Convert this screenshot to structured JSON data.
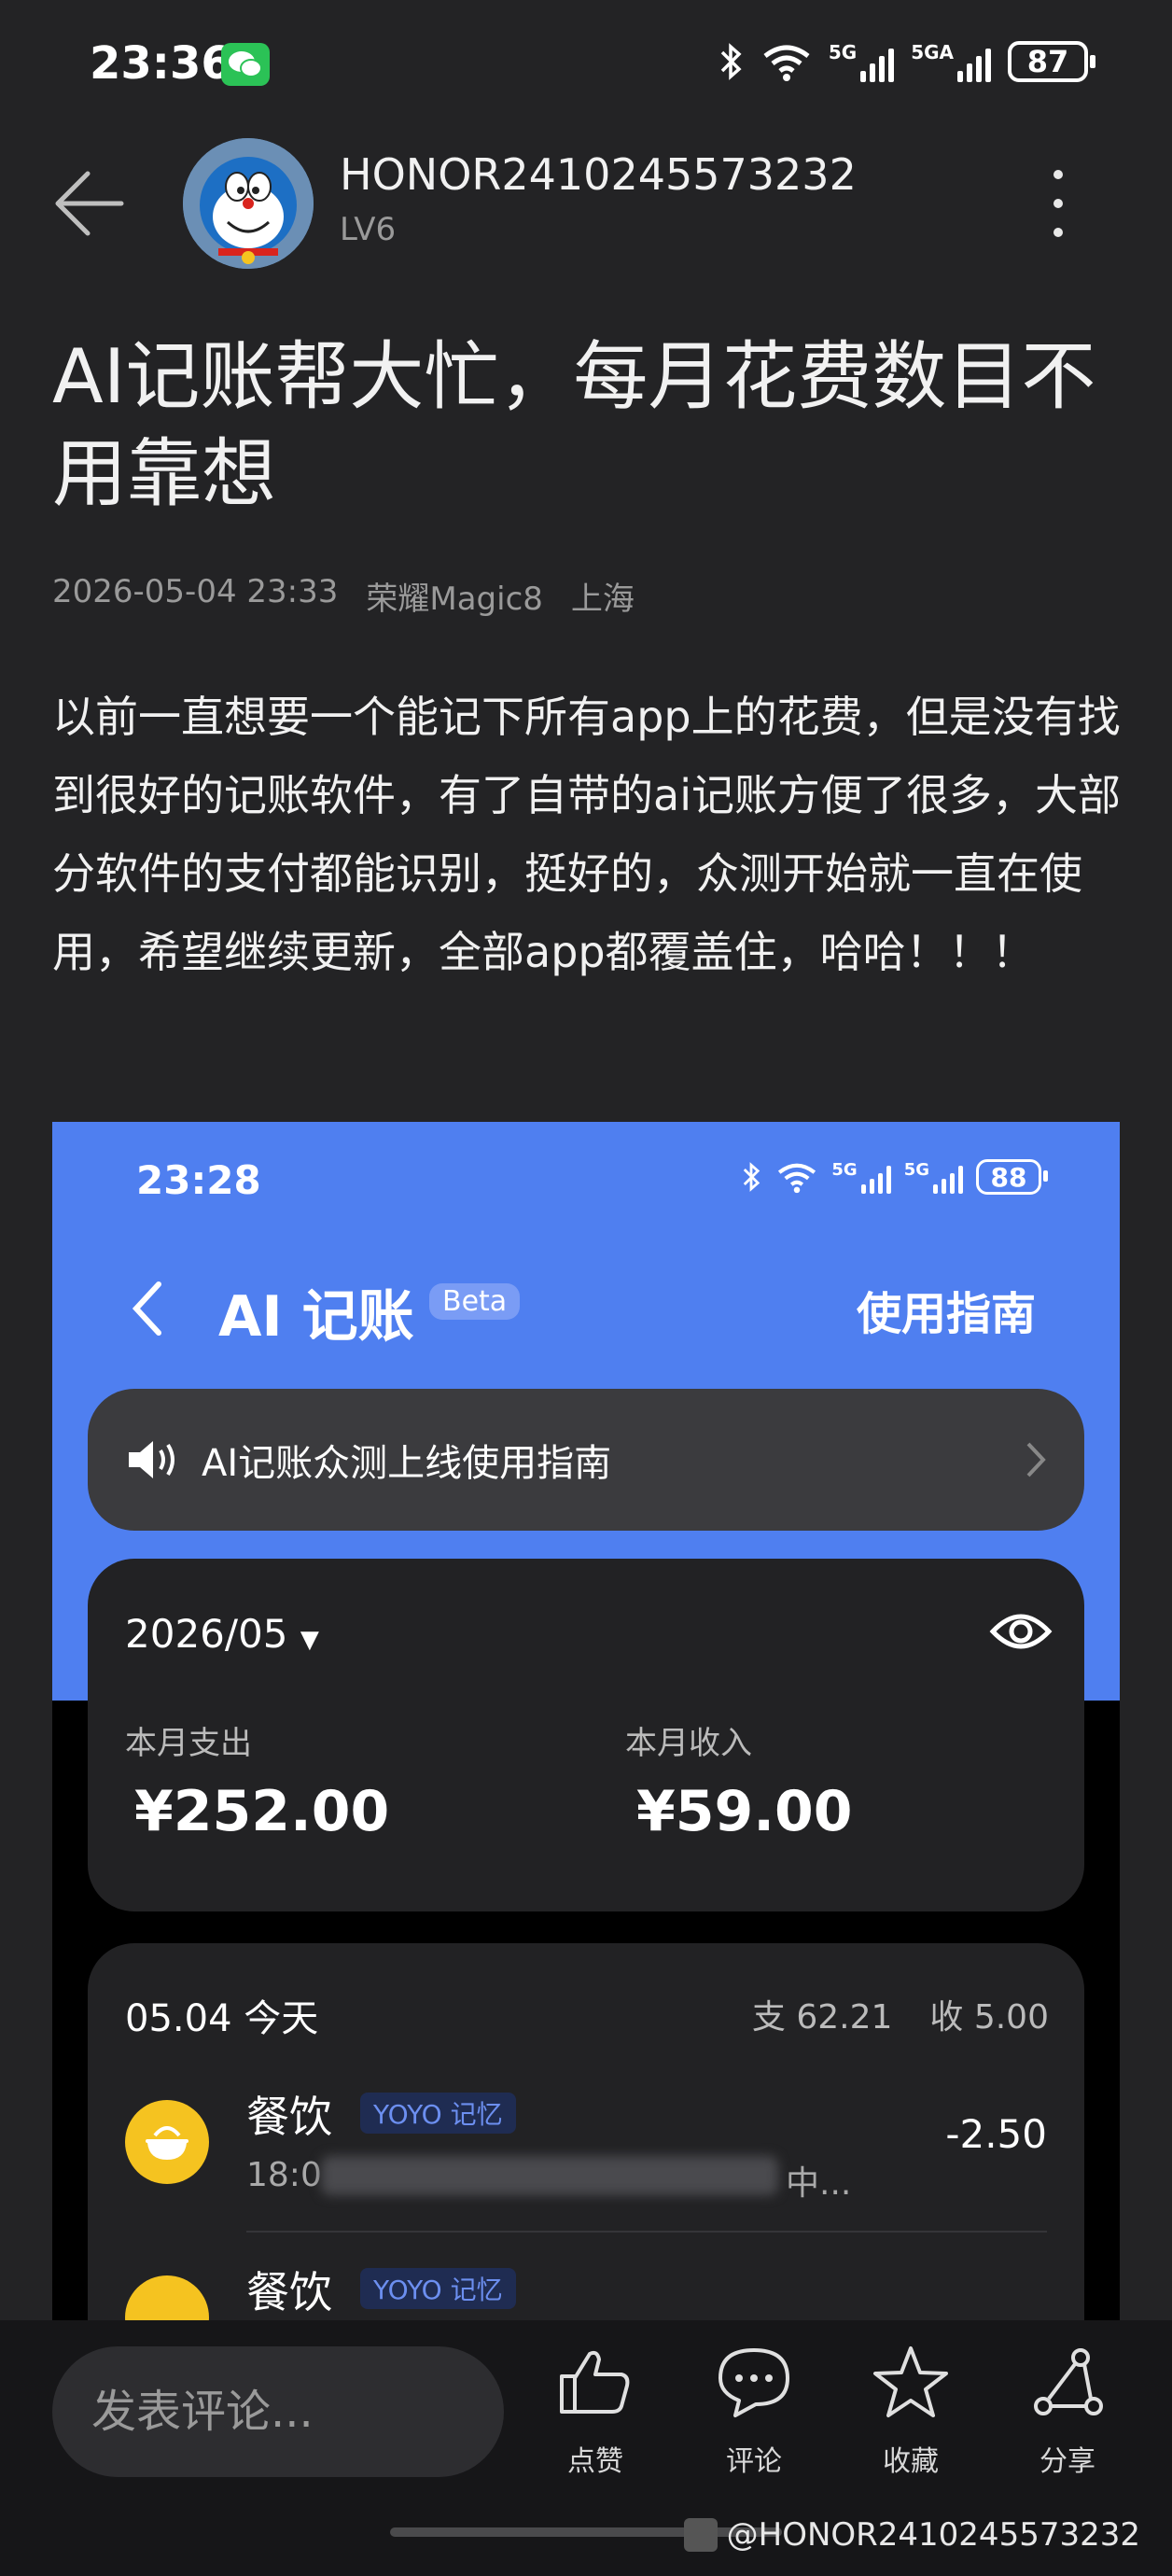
{
  "status_bar": {
    "time": "23:36",
    "sig1_label": "5G",
    "sig2_label": "5GA",
    "battery": "87"
  },
  "author": {
    "name": "HONOR2410245573232",
    "level": "LV6"
  },
  "post": {
    "title": "AI记账帮大忙，每月花费数目不用靠想",
    "datetime": "2026-05-04 23:33",
    "device": "荣耀Magic8",
    "location": "上海",
    "body": "以前一直想要一个能记下所有app上的花费，但是没有找到很好的记账软件，有了自带的ai记账方便了很多，大部分软件的支付都能识别，挺好的，众测开始就一直在使用，希望继续更新，全部app都覆盖住，哈哈！！！"
  },
  "screenshot": {
    "time": "23:28",
    "sig1_label": "5G",
    "sig2_label": "5G",
    "battery": "88",
    "title": "AI 记账",
    "beta": "Beta",
    "guide": "使用指南",
    "notice": "AI记账众测上线使用指南",
    "month": "2026/05",
    "expense_label": "本月支出",
    "expense_value": "¥252.00",
    "income_label": "本月收入",
    "income_value": "¥59.00",
    "day_date": "05.04 今天",
    "day_expense": "支 62.21",
    "day_income": "收 5.00",
    "transactions": [
      {
        "category": "餐饮",
        "source": "YOYO 记忆",
        "time": "18:0",
        "tail": "中...",
        "amount": "-2.50"
      },
      {
        "category": "餐饮",
        "source": "YOYO 记忆",
        "time": "",
        "tail": "",
        "amount": ""
      }
    ]
  },
  "bottom": {
    "comment_placeholder": "发表评论...",
    "like": "点赞",
    "comment": "评论",
    "favorite": "收藏",
    "share": "分享",
    "watermark": "@HONOR2410245573232"
  },
  "colors": {
    "background": "#232325",
    "accent_blue": "#4f7ff0",
    "food_icon": "#f5c320"
  }
}
